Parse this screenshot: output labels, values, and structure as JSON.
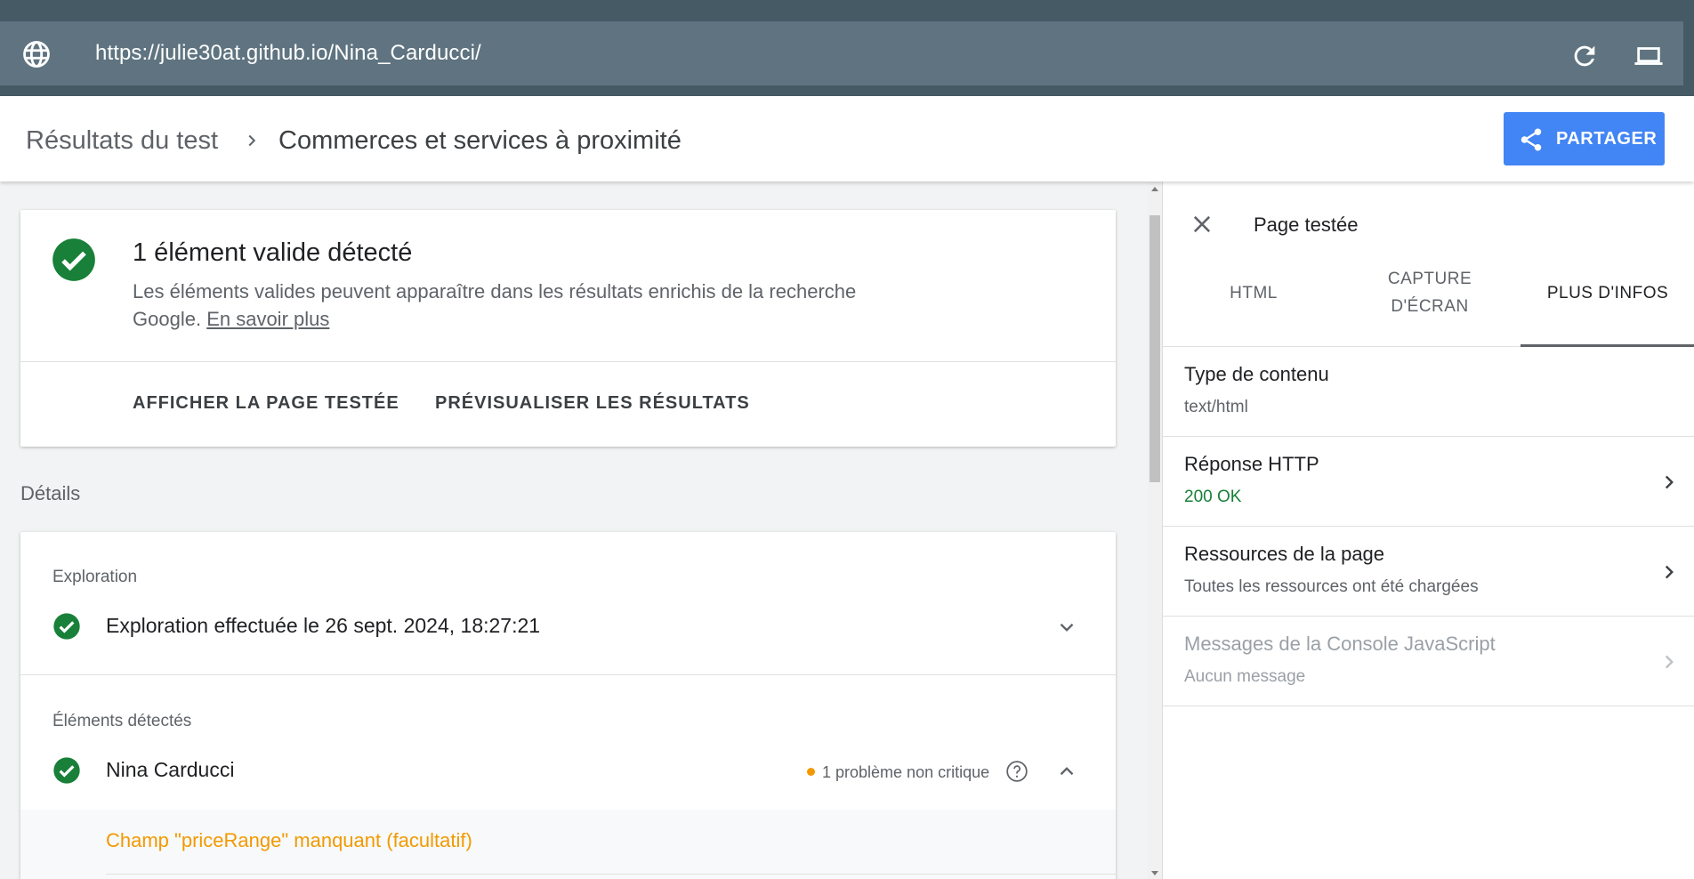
{
  "urlbar": {
    "url": "https://julie30at.github.io/Nina_Carducci/"
  },
  "header": {
    "breadcrumb_root": "Résultats du test",
    "breadcrumb_current": "Commerces et services à proximité",
    "share_label": "PARTAGER"
  },
  "summary": {
    "title": "1 élément valide détecté",
    "description": "Les éléments valides peuvent apparaître dans les résultats enrichis de la recherche Google.",
    "learn_more": "En savoir plus",
    "view_tested_page": "AFFICHER LA PAGE TESTÉE",
    "preview_results": "PRÉVISUALISER LES RÉSULTATS"
  },
  "details": {
    "heading": "Détails",
    "crawl_section": "Exploration",
    "crawl_text": "Exploration effectuée le 26 sept. 2024, 18:27:21",
    "detected_section": "Éléments détectés",
    "item_name": "Nina Carducci",
    "issue_text": "1 problème non critique",
    "warning_text": "Champ \"priceRange\" manquant (facultatif)"
  },
  "panel": {
    "title": "Page testée",
    "tabs": [
      {
        "label": "HTML"
      },
      {
        "label": "CAPTURE D'ÉCRAN"
      },
      {
        "label": "PLUS D'INFOS"
      }
    ],
    "rows": [
      {
        "label": "Type de contenu",
        "value": "text/html"
      },
      {
        "label": "Réponse HTTP",
        "value": "200 OK"
      },
      {
        "label": "Ressources de la page",
        "value": "Toutes les ressources ont été chargées"
      },
      {
        "label": "Messages de la Console JavaScript",
        "value": "Aucun message"
      }
    ]
  },
  "colors": {
    "urlbar_bg": "#5f7480",
    "primary_button": "#4285f4",
    "success_green": "#188038",
    "warning_orange": "#f29900"
  }
}
